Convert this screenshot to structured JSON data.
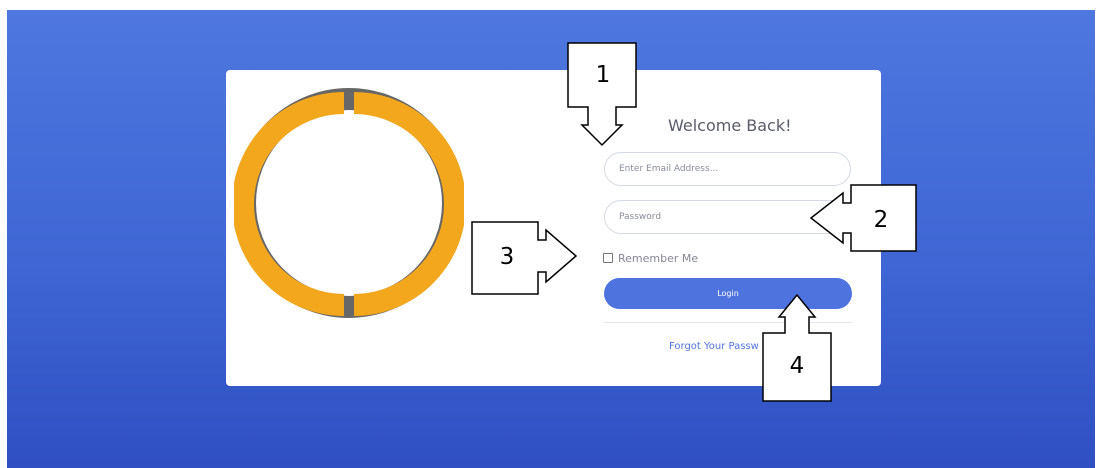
{
  "login": {
    "title": "Welcome Back!",
    "email_placeholder": "Enter Email Address...",
    "password_placeholder": "Password",
    "remember_label": "Remember Me",
    "login_label": "Login",
    "forgot_label": "Forgot Your Passw"
  },
  "logo": {
    "outer_ring_color": "#676767",
    "inner_ring_color": "#f2a71d"
  },
  "annotations": [
    {
      "label": "1",
      "arrow": "down"
    },
    {
      "label": "2",
      "arrow": "left"
    },
    {
      "label": "3",
      "arrow": "right"
    },
    {
      "label": "4",
      "arrow": "up"
    }
  ],
  "colors": {
    "background": "#4a71dc",
    "accent": "#4e73df",
    "card": "#ffffff"
  }
}
